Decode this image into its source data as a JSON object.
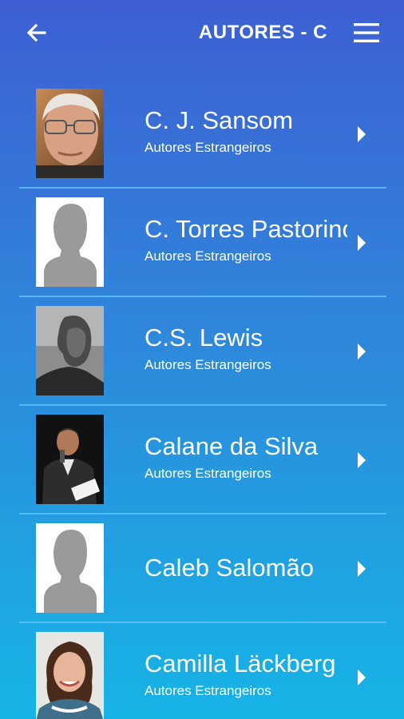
{
  "header": {
    "title": "AUTORES - C",
    "back_icon": "arrow-left-icon",
    "menu_icon": "hamburger-menu-icon"
  },
  "colors": {
    "gradient_top": "#3e5fd3",
    "gradient_bottom": "#16b4e6",
    "divider": "#64c8fa",
    "text": "#ffffff"
  },
  "authors": [
    {
      "name": "C. J. Sansom",
      "category": "Autores Estrangeiros",
      "photo": "portrait-photo"
    },
    {
      "name": "C. Torres Pastorino",
      "category": "Autores Estrangeiros",
      "photo": "placeholder-silhouette"
    },
    {
      "name": "C.S. Lewis",
      "category": "Autores Estrangeiros",
      "photo": "portrait-photo"
    },
    {
      "name": "Calane da Silva",
      "category": "Autores Estrangeiros",
      "photo": "portrait-photo"
    },
    {
      "name": "Caleb Salomão",
      "category": "",
      "photo": "placeholder-silhouette"
    },
    {
      "name": "Camilla Läckberg",
      "category": "Autores Estrangeiros",
      "photo": "portrait-photo"
    }
  ]
}
